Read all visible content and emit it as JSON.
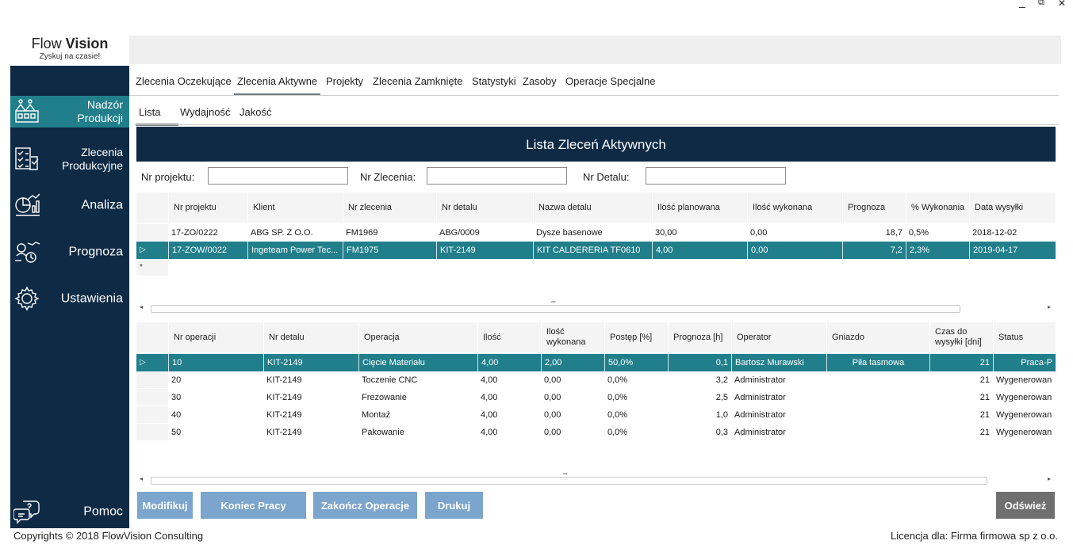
{
  "window": {
    "minimize": "_",
    "restore": "⧉",
    "close": "✕"
  },
  "logo": {
    "brand_light": "Flow",
    "brand_bold": "Vision",
    "tagline": "Zyskuj na czasie!"
  },
  "sidebar": {
    "items": [
      {
        "label_line1": "Nadzór",
        "label_line2": "Produkcji",
        "icon": "factory-icon"
      },
      {
        "label_line1": "Zlecenia",
        "label_line2": "Produkcyjne",
        "icon": "checklist-icon"
      },
      {
        "label": "Analiza",
        "icon": "analytics-icon"
      },
      {
        "label": "Prognoza",
        "icon": "forecast-icon"
      },
      {
        "label": "Ustawienia",
        "icon": "gear-icon"
      }
    ],
    "help": {
      "label": "Pomoc",
      "icon": "help-chat-icon"
    }
  },
  "tabs": [
    "Zlecenia Oczekujące",
    "Zlecenia Aktywne",
    "Projekty",
    "Zlecenia Zamknięte",
    "Statystyki",
    "Zasoby",
    "Operacje Specjalne"
  ],
  "subtabs": [
    "Lista",
    "Wydajność",
    "Jakość"
  ],
  "main": {
    "title": "Lista Zleceń Aktywnych",
    "filters": {
      "project_label": "Nr projektu:",
      "order_label": "Nr Zlecenia:",
      "detail_label": "Nr Detalu:",
      "project_value": "",
      "order_value": "",
      "detail_value": ""
    }
  },
  "orders": {
    "headers": [
      "Nr projektu",
      "Klient",
      "Nr zlecenia",
      "Nr detalu",
      "Nazwa detalu",
      "Ilość planowana",
      "Ilość wykonana",
      "Prognoza",
      "% Wykonania",
      "Data wysyłki"
    ],
    "rows": [
      {
        "indicator": "",
        "cells": [
          "17-ZO/0222",
          "ABG SP. Z O.O.",
          "FM1969",
          "ABG/0009",
          "Dysze basenowe",
          "30,00",
          "0,00",
          "18,7",
          "0,5%",
          "2018-12-02"
        ]
      },
      {
        "indicator": "▷",
        "cells": [
          "17-ZOW/0022",
          "Ingeteam Power Tec...",
          "FM1975",
          "KIT-2149",
          "KIT CALDERERIA TF0610",
          "4,00",
          "0,00",
          "7,2",
          "2,3%",
          "2019-04-17"
        ]
      }
    ],
    "new_row_marker": "*"
  },
  "operations": {
    "headers": [
      "Nr operacji",
      "Nr detalu",
      "Operacja",
      "Ilość",
      "Ilość wykonana",
      "Postęp [%]",
      "Prognoza [h]",
      "Operator",
      "Gniazdo",
      "Czas do wysyłki [dni]",
      "Status"
    ],
    "rows": [
      {
        "indicator": "▷",
        "cells": [
          "10",
          "KIT-2149",
          "Cięcie Materiału",
          "4,00",
          "2,00",
          "50,0%",
          "0,1",
          "Bartosz Murawski",
          "Piła tasmowa",
          "21",
          "Praca-P"
        ]
      },
      {
        "indicator": "",
        "cells": [
          "20",
          "KIT-2149",
          "Toczenie CNC",
          "4,00",
          "0,00",
          "0,0%",
          "3,2",
          "Administrator",
          "",
          "21",
          "Wygenerowan"
        ]
      },
      {
        "indicator": "",
        "cells": [
          "30",
          "KIT-2149",
          "Frezowanie",
          "4,00",
          "0,00",
          "0,0%",
          "2,5",
          "Administrator",
          "",
          "21",
          "Wygenerowan"
        ]
      },
      {
        "indicator": "",
        "cells": [
          "40",
          "KIT-2149",
          "Montaż",
          "4,00",
          "0,00",
          "0,0%",
          "1,0",
          "Administrator",
          "",
          "21",
          "Wygenerowan"
        ]
      },
      {
        "indicator": "",
        "cells": [
          "50",
          "KIT-2149",
          "Pakowanie",
          "4,00",
          "0,00",
          "0,0%",
          "0,3",
          "Administrator",
          "",
          "21",
          "Wygenerowan"
        ]
      }
    ]
  },
  "scroll": {
    "left": "◂",
    "right": "▸",
    "grip": "'''"
  },
  "buttons": {
    "modify": "Modifikuj",
    "end_work": "Koniec Pracy",
    "finish_ops": "Zakończ Operacje",
    "print": "Drukuj",
    "refresh": "Odśwież"
  },
  "footer": {
    "copyright": "Copyrights © 2018 FlowVision Consulting",
    "license": "Licencja dla: Firma firmowa sp z o.o."
  },
  "colors": {
    "navy": "#0e2a45",
    "teal": "#217f8b",
    "button_blue": "#7ba5cd",
    "button_grey": "#6f6f6f"
  }
}
